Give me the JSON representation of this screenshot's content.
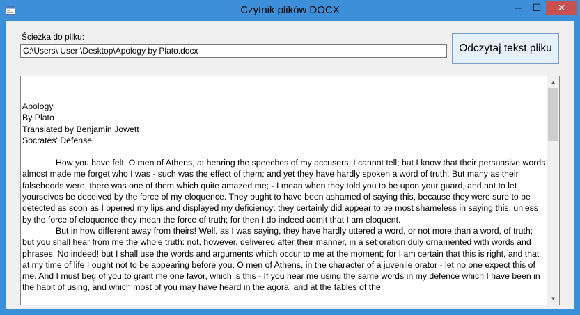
{
  "window": {
    "title": "Czytnik plików DOCX",
    "minimize_glyph": "─",
    "maximize_glyph": "☐",
    "close_glyph": "✕",
    "icon": "app-form-icon"
  },
  "form": {
    "path_label": "Ścieżka do pliku:",
    "path_value": "C:\\Users\\ User \\Desktop\\Apology by Plato.docx",
    "read_button_label": "Odczytaj tekst pliku"
  },
  "document": {
    "header_lines": [
      "Apology",
      "By Plato",
      "Translated by Benjamin Jowett",
      "Socrates' Defense"
    ],
    "paragraphs": [
      "How you have felt, O men of Athens, at hearing the speeches of my accusers, I cannot tell; but I know that their persuasive words almost made me forget who I was - such was the effect of them; and yet they have hardly spoken a word of truth. But many as their falsehoods were, there was one of them which quite amazed me; - I mean when they told you to be upon your guard, and not to let yourselves be deceived by the force of my eloquence. They ought to have been ashamed of saying this, because they were sure to be detected as soon as I opened my lips and displayed my deficiency; they certainly did appear to be most shameless in saying this, unless by the force of eloquence they mean the force of truth; for then I do indeed admit that I am eloquent.",
      "But in how different away from theirs! Well, as I was saying, they have hardly uttered a word, or not more than a word, of truth; but you shall hear from me the whole truth: not, however, delivered after their manner, in a set oration duly ornamented with words and phrases. No indeed! but I shall use the words and arguments which occur to me at the moment; for I am certain that this is right, and that at my time of life I ought not to be appearing before you, O men of Athens, in the character of a juvenile orator - let no one expect this of me. And I must beg of you to grant me one favor, which is this - If you hear me using the same words in my defence which I have been in the habit of using, and which most of you may have heard in the agora, and at the tables of the"
    ]
  },
  "colors": {
    "titlebar": "#3c8fd8",
    "close_button": "#c75050",
    "client_background": "#f0f0f0"
  }
}
